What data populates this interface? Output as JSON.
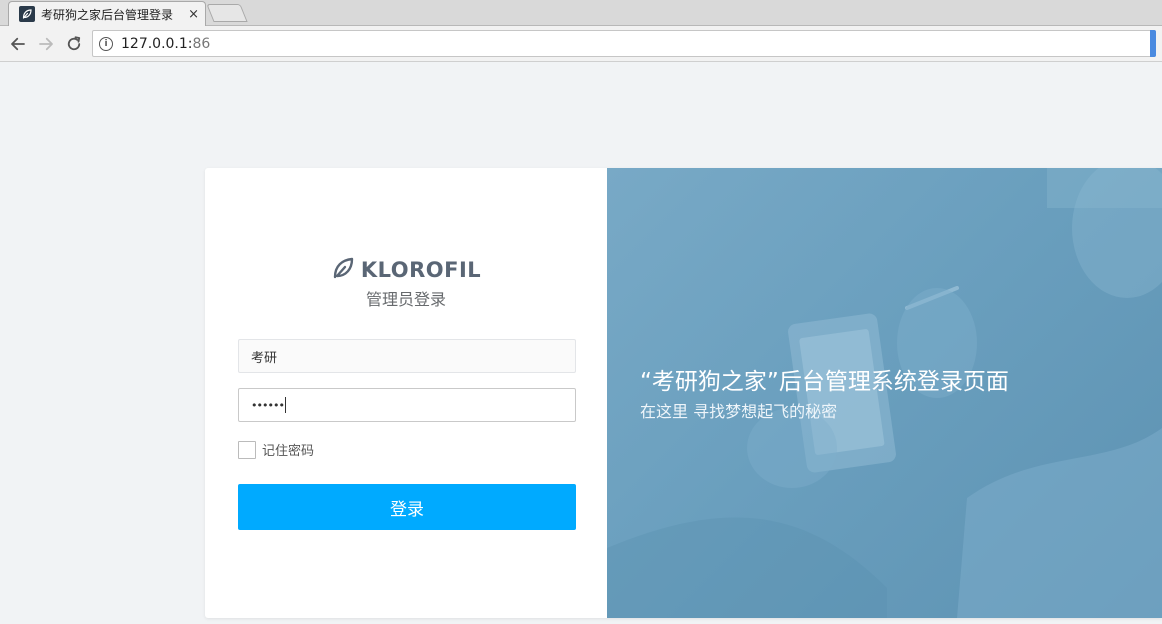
{
  "browser": {
    "tab_title": "考研狗之家后台管理登录",
    "tab_close": "×",
    "url_host": "127.0.0.1:",
    "url_port": "86"
  },
  "brand": {
    "logo_text": "KLOROFIL",
    "subtitle": "管理员登录"
  },
  "form": {
    "username_value": "考研",
    "password_value": "••••••",
    "remember_label": "记住密码",
    "remember_checked": false,
    "submit_label": "登录"
  },
  "hero": {
    "title": "“考研狗之家”后台管理系统登录页面",
    "subtitle": "在这里 寻找梦想起飞的秘密"
  },
  "colors": {
    "accent": "#00aaff",
    "hero_bg": "#6a9fbe",
    "page_bg": "#f1f3f5"
  },
  "icons": {
    "back": "arrow-left-icon",
    "forward": "arrow-right-icon",
    "reload": "reload-icon",
    "site_info": "info-icon",
    "logo": "leaf-icon"
  }
}
